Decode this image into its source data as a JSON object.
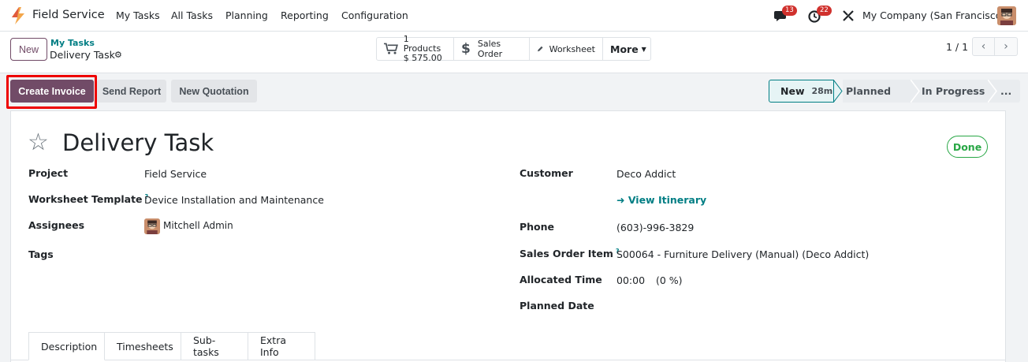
{
  "navbar": {
    "app_name": "Field Service",
    "menus": [
      "My Tasks",
      "All Tasks",
      "Planning",
      "Reporting",
      "Configuration"
    ],
    "messages_count": "13",
    "activities_count": "22",
    "company": "My Company (San Francisco)"
  },
  "control_panel": {
    "new_label": "New",
    "breadcrumb_parent": "My Tasks",
    "breadcrumb_current": "Delivery Task",
    "stat_products_line1": "1 Products",
    "stat_products_line2": "$ 575.00",
    "stat_sales_order": "Sales Order",
    "stat_worksheet": "Worksheet",
    "stat_more": "More",
    "pager": "1 / 1"
  },
  "actions": {
    "create_invoice": "Create Invoice",
    "send_report": "Send Report",
    "new_quotation": "New Quotation"
  },
  "stages": {
    "current": "New",
    "current_time": "28m",
    "planned": "Planned",
    "in_progress": "In Progress",
    "more": "..."
  },
  "task": {
    "title": "Delivery Task",
    "done_label": "Done",
    "project_label": "Project",
    "project_value": "Field Service",
    "worksheet_label": "Worksheet Template",
    "worksheet_value": "Device Installation and Maintenance",
    "assignees_label": "Assignees",
    "assignees_value": "Mitchell Admin",
    "tags_label": "Tags",
    "customer_label": "Customer",
    "customer_value": "Deco Addict",
    "itinerary_link": "View Itinerary",
    "phone_label": "Phone",
    "phone_value": "(603)-996-3829",
    "sales_item_label": "Sales Order Item",
    "sales_item_value": "S00064 - Furniture Delivery (Manual) (Deco Addict)",
    "allocated_label": "Allocated Time",
    "allocated_value": "00:00",
    "allocated_percent": "(0 %)",
    "planned_date_label": "Planned Date",
    "help_mark": "?"
  },
  "tabs": [
    "Description",
    "Timesheets",
    "Sub-tasks",
    "Extra Info"
  ],
  "colors": {
    "brand": "#714b67",
    "link": "#017e84",
    "badge": "#d0312d",
    "success": "#28a745",
    "highlight": "#ee0000"
  }
}
